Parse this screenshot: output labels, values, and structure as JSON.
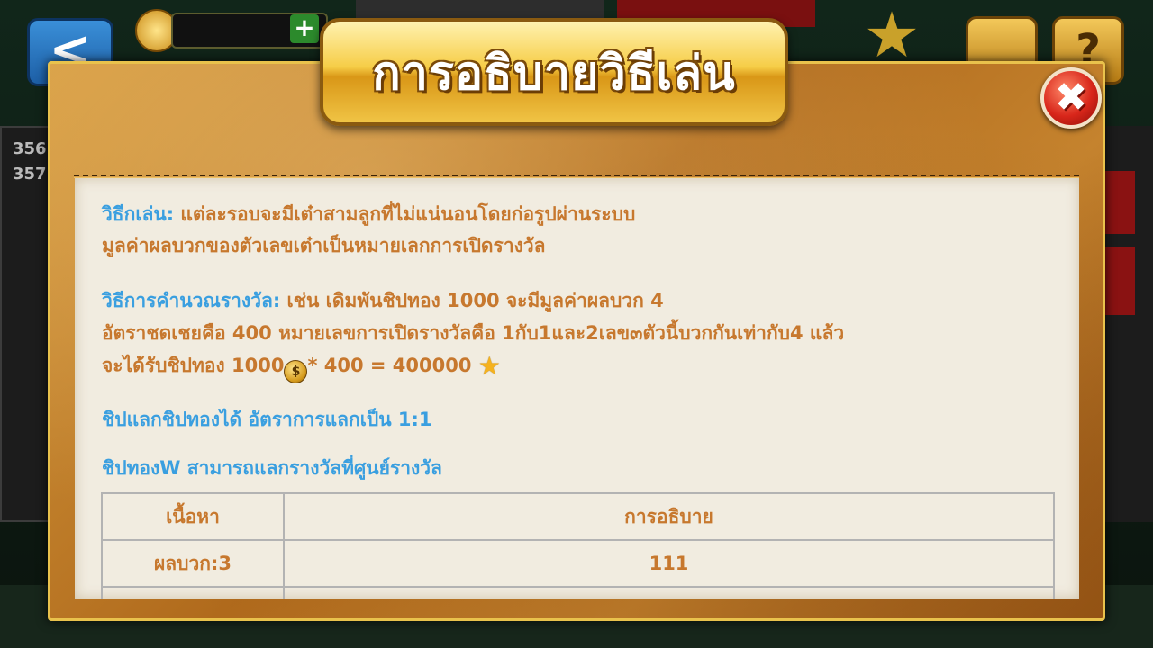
{
  "background": {
    "back_icon": "chevron-left-icon",
    "coin_plus": "+",
    "help_glyph": "?",
    "side_numbers": [
      "356",
      "357"
    ]
  },
  "modal": {
    "title": "การอธิบายวิธีเล่น",
    "close_glyph": "✖",
    "paragraphs": {
      "how_to_play_label": "วิธีกเล่น:",
      "how_to_play_line1": " แต่ละรอบจะมีเต๋าสามลูกที่ไม่แน่นอนโดยก่อรูปผ่านระบบ",
      "how_to_play_line2": "มูลค่าผลบวกของตัวเลขเต๋าเป็นหมายเลกการเปิดรางวัล",
      "calc_label": "วิธีการคำนวณรางวัล:",
      "calc_line1": " เช่น เดิมพันชิปทอง 1000 จะมีมูลค่าผลบวก 4",
      "calc_line2": "อัตราชดเชยคือ 400  หมายเลขการเปิดรางวัลคือ 1กับ1และ2เลข๓ตัวนี้บวกกันเท่ากับ4 แล้ว",
      "calc_line3_a": "จะได้รับชิปทอง 1000",
      "calc_line3_b": "* 400 = 400000",
      "exchange": "ชิปแลกชิปทองได้ อัตราการแลกเป็น 1:1",
      "gold_w": "ชิปทองW สามารถแลกรางวัลที่ศูนย์รางวัล"
    },
    "table": {
      "headers": [
        "เนื้อหา",
        "การอธิบาย"
      ],
      "rows": [
        [
          "ผลบวก:3",
          "111"
        ]
      ]
    }
  }
}
